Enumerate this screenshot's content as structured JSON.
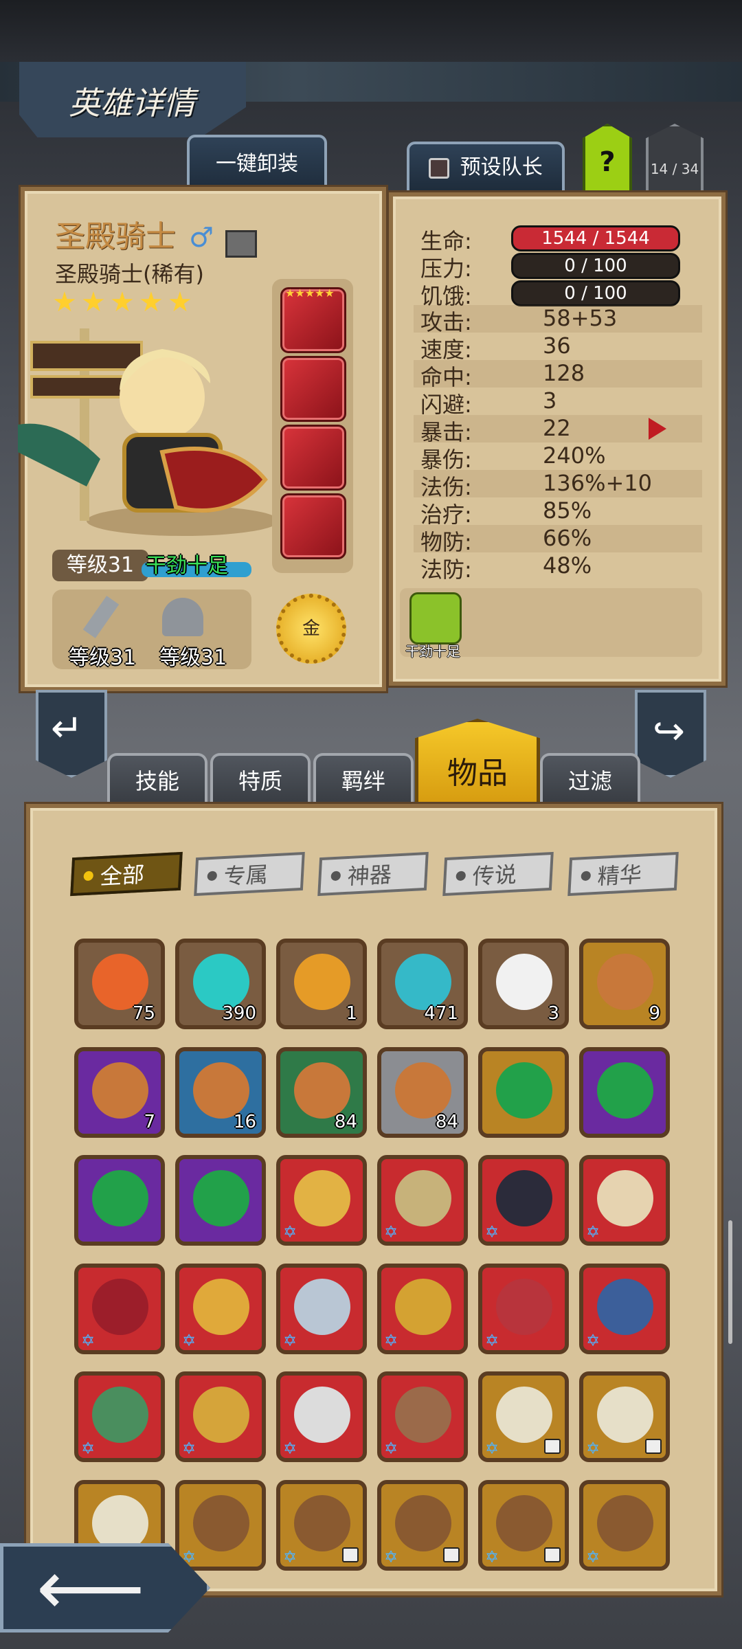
{
  "header": {
    "title": "英雄详情"
  },
  "top_tabs": {
    "unequip_all": "一键卸装",
    "preset_leader": "预设队长",
    "help": "?",
    "page_counter": "14 / 34"
  },
  "hero": {
    "name": "圣殿骑士",
    "gender_symbol": "♂",
    "subtitle": "圣殿骑士(稀有)",
    "stars": 5,
    "level_label": "等级31",
    "mood": "干劲十足",
    "weapon_level": "等级31",
    "armor_level": "等级31",
    "gold_label": "金"
  },
  "stats": {
    "hp_label": "生命:",
    "hp_value": "1544 / 1544",
    "stress_label": "压力:",
    "stress_value": "0 / 100",
    "hunger_label": "饥饿:",
    "hunger_value": "0 / 100",
    "rows": [
      {
        "label": "攻击:",
        "value": "58+53"
      },
      {
        "label": "速度:",
        "value": "36"
      },
      {
        "label": "命中:",
        "value": "128"
      },
      {
        "label": "闪避:",
        "value": "3"
      },
      {
        "label": "暴击:",
        "value": "22"
      },
      {
        "label": "暴伤:",
        "value": "240%"
      },
      {
        "label": "法伤:",
        "value": "136%+10"
      },
      {
        "label": "治疗:",
        "value": "85%"
      },
      {
        "label": "物防:",
        "value": "66%"
      },
      {
        "label": "法防:",
        "value": "48%"
      }
    ],
    "buff_label": "干劲十足"
  },
  "bottom_tabs": [
    "技能",
    "特质",
    "羁绊",
    "物品",
    "过滤"
  ],
  "filters": [
    "全部",
    "专属",
    "神器",
    "传说",
    "精华"
  ],
  "items": [
    {
      "rarity": "gray",
      "count": "75",
      "icon": "rune-orange"
    },
    {
      "rarity": "gray",
      "count": "390",
      "icon": "rune-teal"
    },
    {
      "rarity": "gray",
      "count": "1",
      "icon": "feather-gold"
    },
    {
      "rarity": "gray",
      "count": "471",
      "icon": "potion-teal"
    },
    {
      "rarity": "gray",
      "count": "3",
      "icon": "feather-white"
    },
    {
      "rarity": "gold",
      "count": "9",
      "icon": "chest"
    },
    {
      "rarity": "purple",
      "count": "7",
      "icon": "chest"
    },
    {
      "rarity": "blue",
      "count": "16",
      "icon": "chest"
    },
    {
      "rarity": "green",
      "count": "84",
      "icon": "chest"
    },
    {
      "rarity": "silver",
      "count": "84",
      "icon": "chest"
    },
    {
      "rarity": "gold",
      "count": "",
      "icon": "green-gem"
    },
    {
      "rarity": "purple",
      "count": "",
      "icon": "green-gem"
    },
    {
      "rarity": "purple",
      "count": "",
      "icon": "green-gem"
    },
    {
      "rarity": "purple",
      "count": "",
      "icon": "green-gem"
    },
    {
      "rarity": "red",
      "count": "",
      "icon": "hood"
    },
    {
      "rarity": "red",
      "count": "",
      "icon": "shield-laurel"
    },
    {
      "rarity": "red",
      "count": "",
      "icon": "dark-blade"
    },
    {
      "rarity": "red",
      "count": "",
      "icon": "horn"
    },
    {
      "rarity": "red",
      "count": "",
      "icon": "axe"
    },
    {
      "rarity": "red",
      "count": "",
      "icon": "ring"
    },
    {
      "rarity": "red",
      "count": "",
      "icon": "crown"
    },
    {
      "rarity": "red",
      "count": "",
      "icon": "gauntlet"
    },
    {
      "rarity": "red",
      "count": "",
      "icon": "mask"
    },
    {
      "rarity": "red",
      "count": "",
      "icon": "glove"
    },
    {
      "rarity": "red",
      "count": "",
      "icon": "cross-staff"
    },
    {
      "rarity": "red",
      "count": "",
      "icon": "spear"
    },
    {
      "rarity": "red",
      "count": "",
      "icon": "flask"
    },
    {
      "rarity": "red",
      "count": "",
      "icon": "cloak"
    },
    {
      "rarity": "gold",
      "count": "",
      "icon": "amulet",
      "locked": true
    },
    {
      "rarity": "gold",
      "count": "",
      "icon": "amulet",
      "locked": true
    },
    {
      "rarity": "gold",
      "count": "",
      "icon": "amulet",
      "locked": true
    },
    {
      "rarity": "gold",
      "count": "",
      "icon": "boots"
    },
    {
      "rarity": "gold",
      "count": "",
      "icon": "boots",
      "locked": true
    },
    {
      "rarity": "gold",
      "count": "",
      "icon": "boots",
      "locked": true
    },
    {
      "rarity": "gold",
      "count": "",
      "icon": "boots",
      "locked": true
    },
    {
      "rarity": "gold",
      "count": "",
      "icon": "boots"
    }
  ],
  "colors": {
    "hp": "#c92a35",
    "accent_gold": "#f2c20e",
    "panel": "#d8c39a"
  }
}
